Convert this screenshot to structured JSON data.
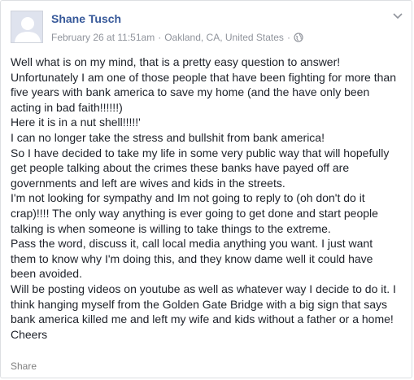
{
  "post": {
    "author": "Shane Tusch",
    "date": "February 26 at 11:51am",
    "separator": "·",
    "location": "Oakland, CA, United States",
    "audience_icon": "globe-icon",
    "menu_icon": "chevron-down-icon",
    "lines": [
      "Well what is on my mind, that is a pretty easy question to answer!",
      "Unfortunately I am one of those people that have been fighting for more than",
      "five years with bank america to save my home (and the have only been",
      "acting in bad faith!!!!!!)",
      "Here it is in a nut shell!!!!!'",
      "I can no longer take the stress and bullshit from bank america!",
      "So I have decided to take my life in some very public way that will hopefully",
      "get people talking about the crimes these banks have payed off are",
      "governments and left are wives and kids in the streets.",
      "I'm not looking for sympathy and Im not going to reply to (oh don't do it",
      "crap)!!!! The only way anything is ever going to get done and start people",
      "talking is when someone is willing to take things to the extreme.",
      "Pass the word, discuss it, call local media anything you want. I just want",
      "them to know why I'm doing this, and they know dame well it could have",
      "been avoided.",
      "Will be posting videos on youtube as well as whatever way I decide to do it. I",
      "think hanging myself from the Golden Gate Bridge with a big sign that says",
      "bank america killed me and left my wife and kids without a father or a home!",
      "Cheers"
    ]
  },
  "actions": {
    "share_label": "Share"
  },
  "colors": {
    "author_link": "#365899",
    "meta_text": "#90949c",
    "body_text": "#1d2129",
    "action_text": "#7f7f7f"
  }
}
